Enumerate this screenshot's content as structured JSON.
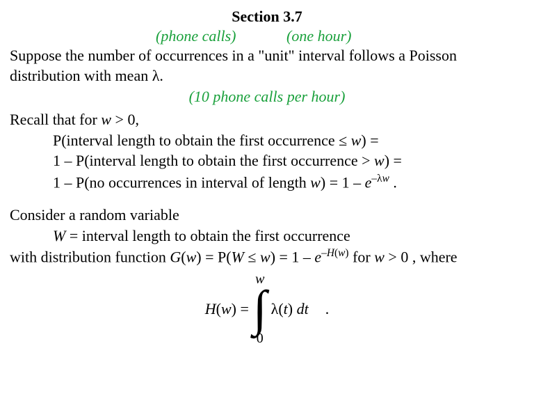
{
  "title": "Section 3.7",
  "annotations": {
    "phone_calls": "(phone calls)",
    "one_hour": "(one hour)",
    "rate": "(10 phone calls per hour)"
  },
  "intro": {
    "line1": "Suppose the number of occurrences in a \"unit\" interval follows a Poisson",
    "line2_pre": "distribution with mean ",
    "line2_lambda": "λ",
    "line2_post": "."
  },
  "recall": {
    "lead_pre": "Recall that for ",
    "lead_var": "w",
    "lead_post": " > 0,",
    "p_line_pre": "P(interval length to obtain the first occurrence ",
    "p_line_rel": "≤",
    "p_line_w": " w",
    "p_line_post": ") =",
    "one_minus_p_pre": "1 – P(interval length to obtain the first occurrence > ",
    "one_minus_p_w": "w",
    "one_minus_p_post": ") =",
    "no_occ_pre": "1 – P(no occurrences in interval of length ",
    "no_occ_w": "w",
    "no_occ_mid": ") =",
    "no_occ_mid_spacer": " ",
    "no_occ_expr_pre": "1 – ",
    "no_occ_e": "e",
    "no_occ_exp_minus": "–",
    "no_occ_exp_lambda": "λ",
    "no_occ_exp_w": "w",
    "no_occ_end": " ."
  },
  "rv": {
    "lead": "Consider a random variable",
    "def_W": "W",
    "def_rest": " = interval length to obtain the first occurrence",
    "dist_pre": "with distribution function ",
    "dist_G": "G",
    "dist_Gargs_open": "(",
    "dist_Gargs_w": "w",
    "dist_Gargs_close": ") = P(",
    "dist_W": "W",
    "dist_leq": " ≤ ",
    "dist_w2": "w",
    "dist_close": ") = 1 – ",
    "dist_e": "e",
    "dist_exp_minus": "–",
    "dist_exp_H": "H",
    "dist_exp_open": "(",
    "dist_exp_w": "w",
    "dist_exp_close": ")",
    "dist_for": " for ",
    "dist_w3": "w",
    "dist_tail": " > 0 , where"
  },
  "integral": {
    "Hw_pre": "H",
    "Hw_open": "(",
    "Hw_w": "w",
    "Hw_close": ") = ",
    "upper": "w",
    "lower": "0",
    "lambda": "λ",
    "t_open": "(",
    "t": "t",
    "t_close": ") ",
    "dt": "dt",
    "period": "."
  }
}
